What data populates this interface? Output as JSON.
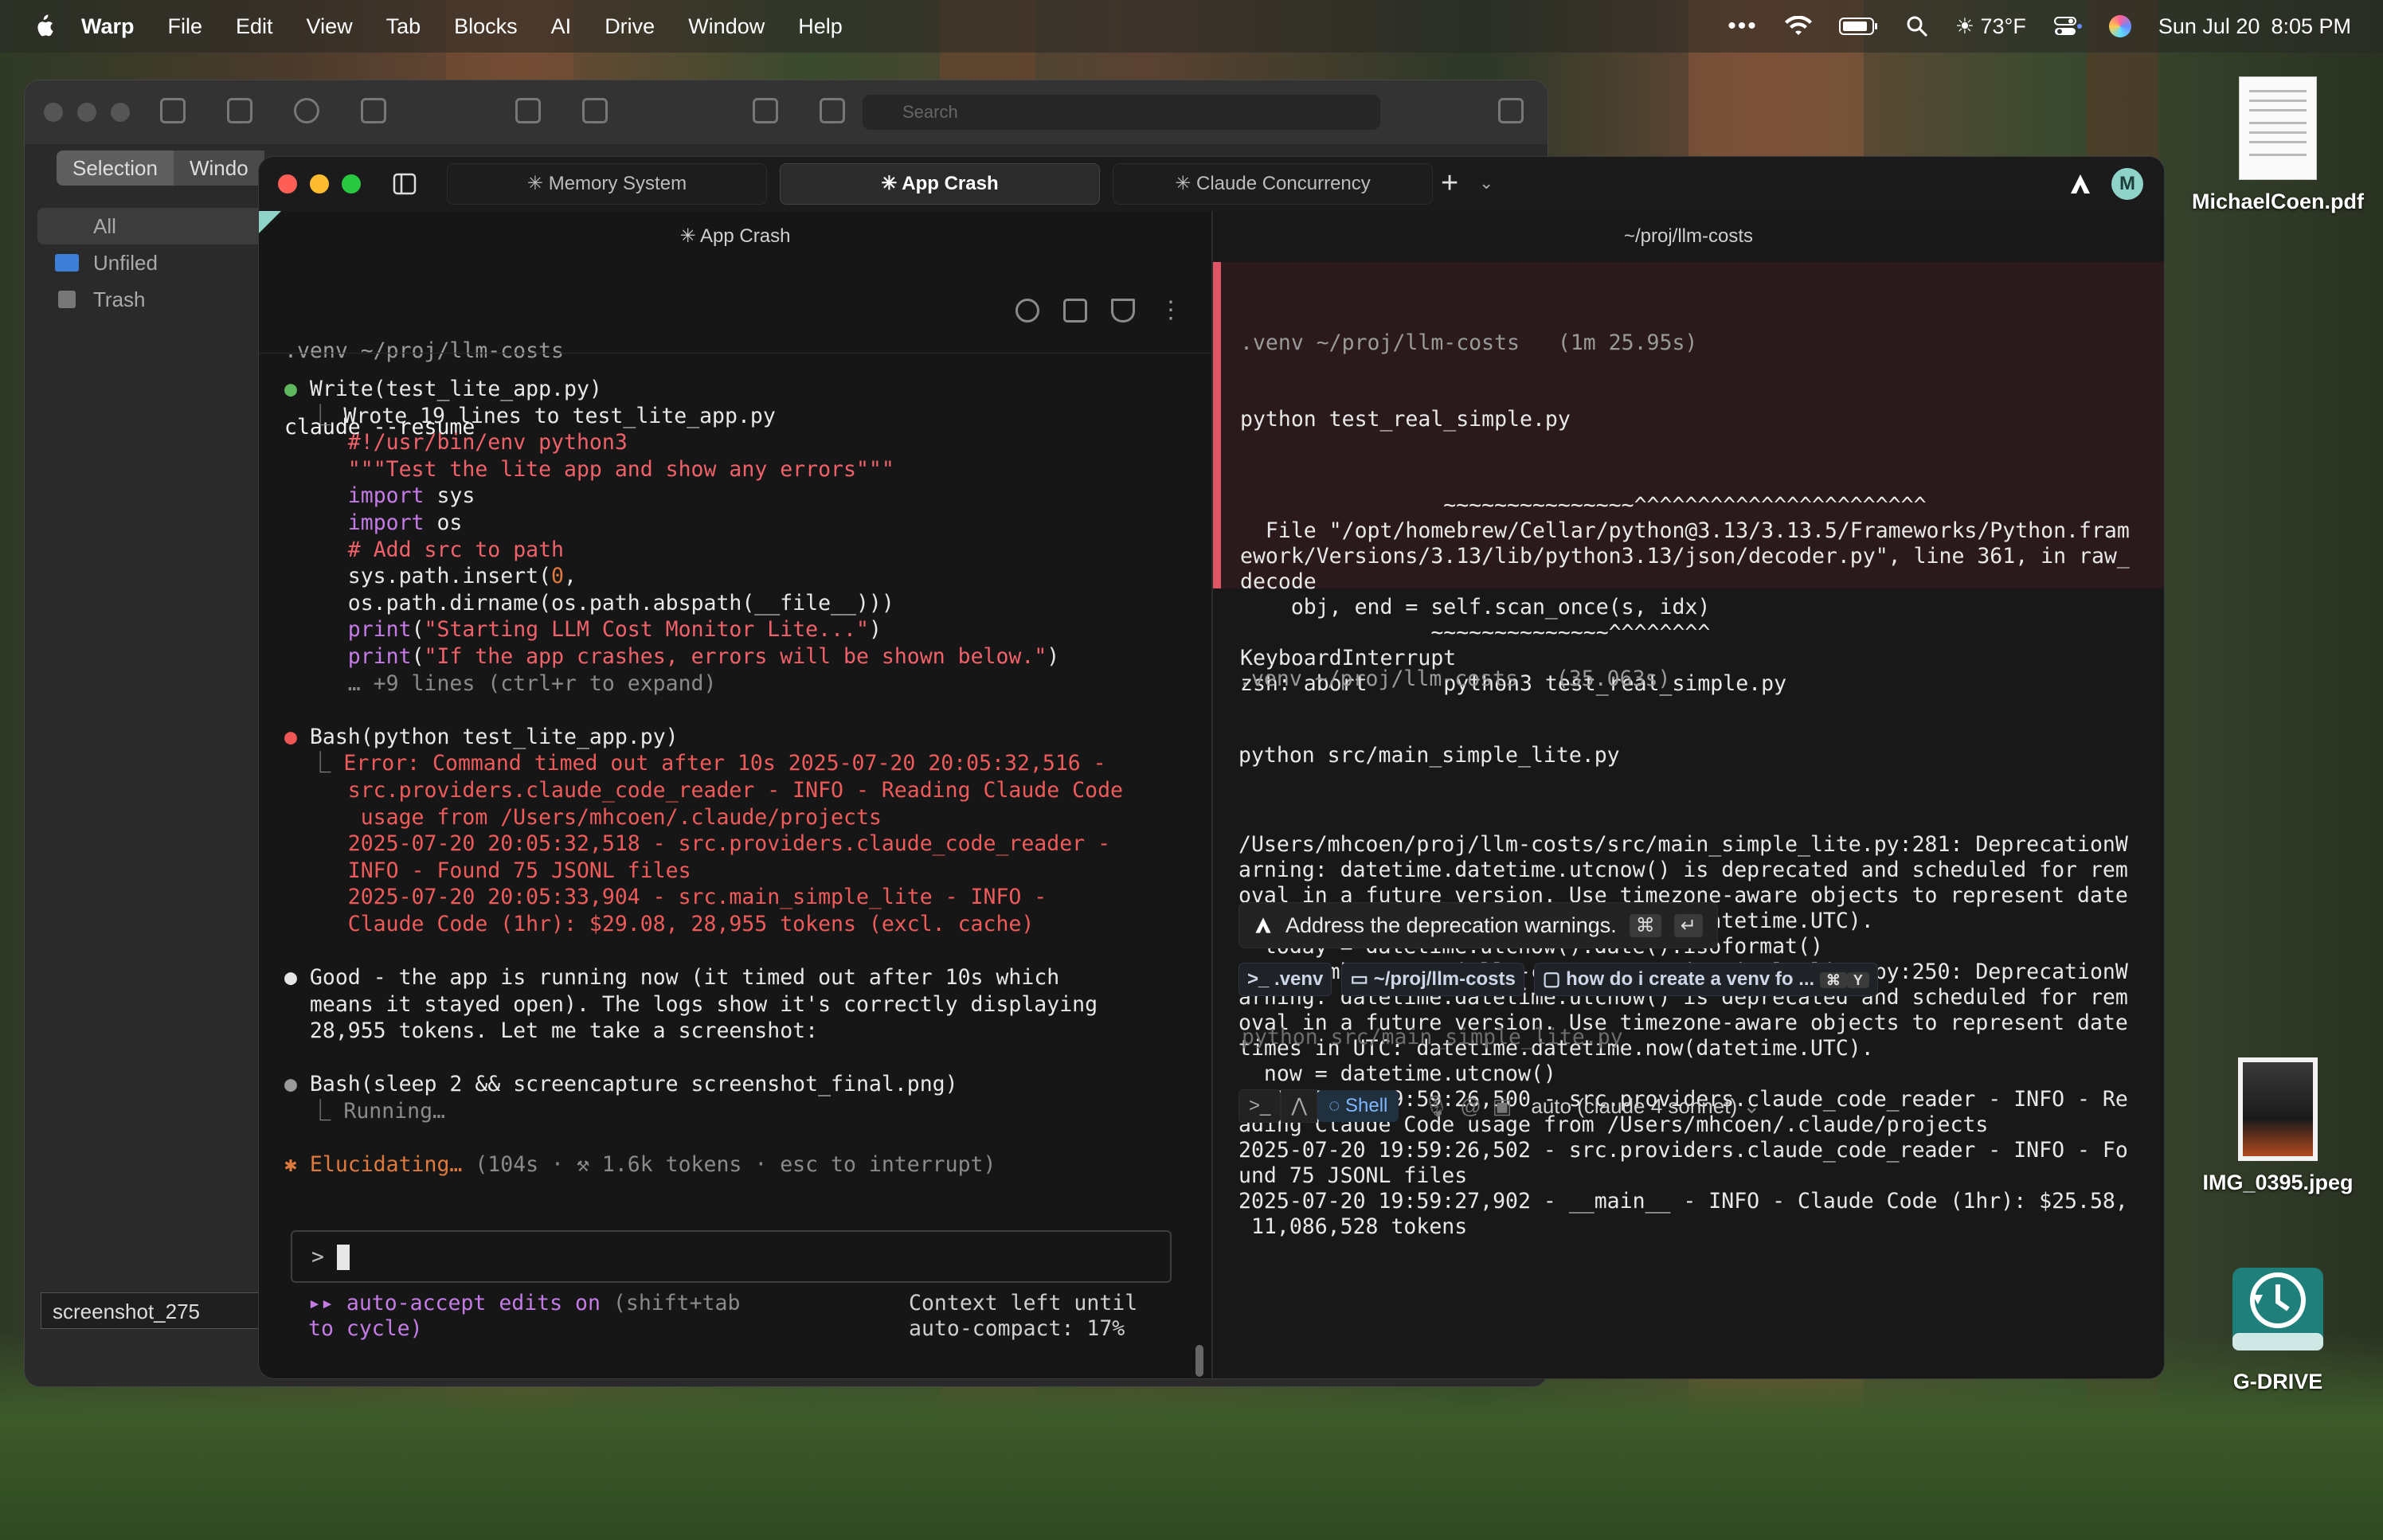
{
  "menubar": {
    "app": "Warp",
    "items": [
      "File",
      "Edit",
      "View",
      "Tab",
      "Blocks",
      "AI",
      "Drive",
      "Window",
      "Help"
    ],
    "weather": "73°F",
    "date": "Sun Jul 20",
    "time": "8:05 PM"
  },
  "backwin": {
    "search_placeholder": "Search",
    "seg": [
      "Selection",
      "Windo"
    ],
    "side": [
      "All",
      "Unfiled",
      "Trash"
    ],
    "field": "screenshot_275"
  },
  "tabs": [
    "Memory System",
    "App Crash",
    "Claude Concurrency"
  ],
  "avatar": "M",
  "left": {
    "header": "App Crash",
    "prompt_dir": ".venv ~/proj/llm-costs",
    "prompt_cmd": "claude --resume",
    "lines": [
      [
        [
          "bullet-g",
          "● "
        ],
        [
          "w",
          "Write(test_lite_app.py)"
        ]
      ],
      [
        [
          "g",
          "  ⎿ "
        ],
        [
          "w",
          "Wrote 19 lines to test_lite_app.py"
        ]
      ],
      [
        [
          "w",
          "     "
        ],
        [
          "pk",
          "#!/usr/bin/env python3"
        ]
      ],
      [
        [
          "w",
          "     "
        ],
        [
          "pk",
          "\"\"\"Test the lite app and show any errors\"\"\""
        ]
      ],
      [
        [
          "w",
          "     "
        ],
        [
          "pl",
          "import"
        ],
        [
          "w",
          " sys"
        ]
      ],
      [
        [
          "w",
          "     "
        ],
        [
          "pl",
          "import"
        ],
        [
          "w",
          " os"
        ]
      ],
      [
        [
          "w",
          "     "
        ],
        [
          "pk",
          "# Add src to path"
        ]
      ],
      [
        [
          "w",
          "     sys.path.insert("
        ],
        [
          "or",
          "0"
        ],
        [
          "w",
          ","
        ]
      ],
      [
        [
          "w",
          "     os.path.dirname(os.path.abspath(__file__)))"
        ]
      ],
      [
        [
          "w",
          "     "
        ],
        [
          "pl",
          "print"
        ],
        [
          "w",
          "("
        ],
        [
          "pk",
          "\"Starting LLM Cost Monitor Lite...\""
        ],
        [
          "w",
          ")"
        ]
      ],
      [
        [
          "w",
          "     "
        ],
        [
          "pl",
          "print"
        ],
        [
          "w",
          "("
        ],
        [
          "pk",
          "\"If the app crashes, errors will be shown below.\""
        ],
        [
          "w",
          ")"
        ]
      ],
      [
        [
          "g",
          "     … +9 lines (ctrl+r to expand)"
        ]
      ],
      [
        [
          "w",
          ""
        ]
      ],
      [
        [
          "bullet-r",
          "● "
        ],
        [
          "w",
          "Bash(python test_lite_app.py)"
        ]
      ],
      [
        [
          "g",
          "  ⎿ "
        ],
        [
          "r",
          "Error: Command timed out after 10s 2025-07-20 20:05:32,516 -"
        ]
      ],
      [
        [
          "r",
          "     src.providers.claude_code_reader - INFO - Reading Claude Code"
        ]
      ],
      [
        [
          "r",
          "      usage from /Users/mhcoen/.claude/projects"
        ]
      ],
      [
        [
          "r",
          "     2025-07-20 20:05:32,518 - src.providers.claude_code_reader -"
        ]
      ],
      [
        [
          "r",
          "     INFO - Found 75 JSONL files"
        ]
      ],
      [
        [
          "r",
          "     2025-07-20 20:05:33,904 - src.main_simple_lite - INFO -"
        ]
      ],
      [
        [
          "r",
          "     Claude Code (1hr): $29.08, 28,955 tokens (excl. cache)"
        ]
      ],
      [
        [
          "w",
          ""
        ]
      ],
      [
        [
          "bullet-w",
          "● "
        ],
        [
          "w",
          "Good - the app is running now (it timed out after 10s which"
        ]
      ],
      [
        [
          "w",
          "  means it stayed open). The logs show it's correctly displaying"
        ]
      ],
      [
        [
          "w",
          "  28,955 tokens. Let me take a screenshot:"
        ]
      ],
      [
        [
          "w",
          ""
        ]
      ],
      [
        [
          "bullet-gr",
          "● "
        ],
        [
          "w",
          "Bash(sleep 2 && screencapture screenshot_final.png)"
        ]
      ],
      [
        [
          "g",
          "  ⎿ Running…"
        ]
      ],
      [
        [
          "w",
          ""
        ]
      ],
      [
        [
          "or",
          "✱ Elucidating… "
        ],
        [
          "g",
          "(104s · ⚒ 1.6k tokens · esc to interrupt)"
        ]
      ]
    ],
    "input_prompt": ">",
    "footer_left_1a": "▸▸ auto-accept edits on",
    "footer_left_1b": " (shift+tab",
    "footer_left_2": "to cycle)",
    "footer_right_1": "Context left until",
    "footer_right_2": "auto-compact: 17%"
  },
  "right": {
    "header": "~/proj/llm-costs",
    "block1_prompt": ".venv ~/proj/llm-costs   (1m 25.95s)",
    "block1_cmd": "python test_real_simple.py",
    "block1_lines": [
      "                ~~~~~~~~~~~~~~~^^^^^^^^^^^^^^^^^^^^^^^",
      "  File \"/opt/homebrew/Cellar/python@3.13/3.13.5/Frameworks/Python.fram",
      "ework/Versions/3.13/lib/python3.13/json/decoder.py\", line 361, in raw_",
      "decode",
      "    obj, end = self.scan_once(s, idx)",
      "               ~~~~~~~~~~~~~~^^^^^^^^",
      "KeyboardInterrupt",
      "zsh: abort      python3 test_real_simple.py"
    ],
    "block2_prompt": ".venv ~/proj/llm-costs   (35.063s)",
    "block2_cmd": "python src/main_simple_lite.py",
    "block2_lines": [
      "/Users/mhcoen/proj/llm-costs/src/main_simple_lite.py:281: DeprecationW",
      "arning: datetime.datetime.utcnow() is deprecated and scheduled for rem",
      "oval in a future version. Use timezone-aware objects to represent date",
      "times in UTC: datetime.datetime.now(datetime.UTC).",
      "  today = datetime.utcnow().date().isoformat()",
      "/Users/mhcoen/proj/llm-costs/src/main_simple_lite.py:250: DeprecationW",
      "arning: datetime.datetime.utcnow() is deprecated and scheduled for rem",
      "oval in a future version. Use timezone-aware objects to represent date",
      "times in UTC: datetime.datetime.now(datetime.UTC).",
      "  now = datetime.utcnow()",
      "2025-07-20 19:59:26,500 - src.providers.claude_code_reader - INFO - Re",
      "ading Claude Code usage from /Users/mhcoen/.claude/projects",
      "2025-07-20 19:59:26,502 - src.providers.claude_code_reader - INFO - Fo",
      "und 75 JSONL files",
      "2025-07-20 19:59:27,902 - __main__ - INFO - Claude Code (1hr): $25.58,",
      " 11,086,528 tokens"
    ],
    "suggestion": "Address the deprecation warnings.",
    "ctx_venv": ".venv",
    "ctx_dir": "~/proj/llm-costs",
    "ctx_convo": "how do i create a venv fo ...",
    "ghost_cmd": "python src/main_simple_lite.py",
    "shell_label": "Shell",
    "model": "auto (claude 4 sonnet)"
  },
  "desktop": [
    "MichaelCoen.pdf",
    "IMG_0395.jpeg",
    "G-DRIVE"
  ]
}
